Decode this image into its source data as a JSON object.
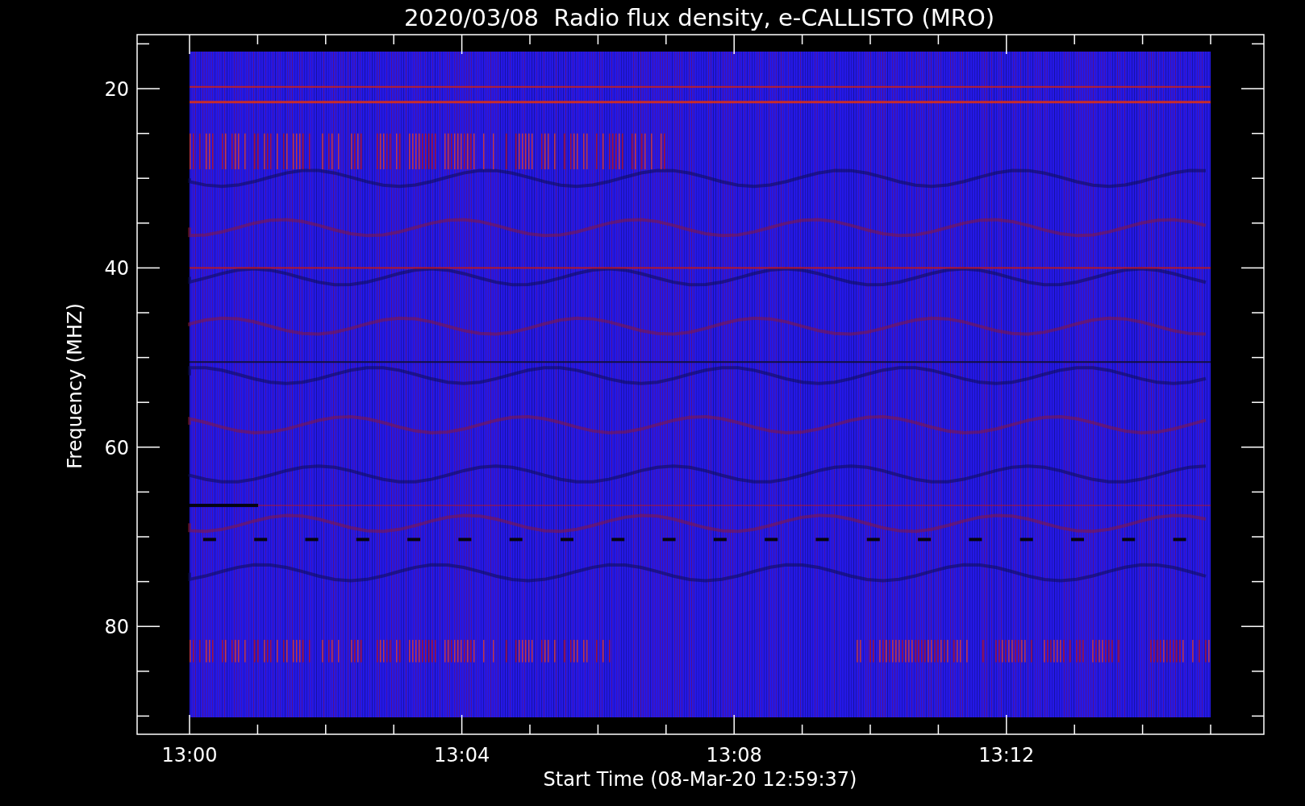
{
  "title": "2020/03/08  Radio flux density, e-CALLISTO (MRO)",
  "y_axis": {
    "label": "Frequency (MHZ)",
    "ticks": [
      "20",
      "40",
      "60",
      "80"
    ]
  },
  "x_axis": {
    "label": "Start Time (08-Mar-20 12:59:37)",
    "ticks": [
      "13:00",
      "13:04",
      "13:08",
      "13:12"
    ]
  }
}
